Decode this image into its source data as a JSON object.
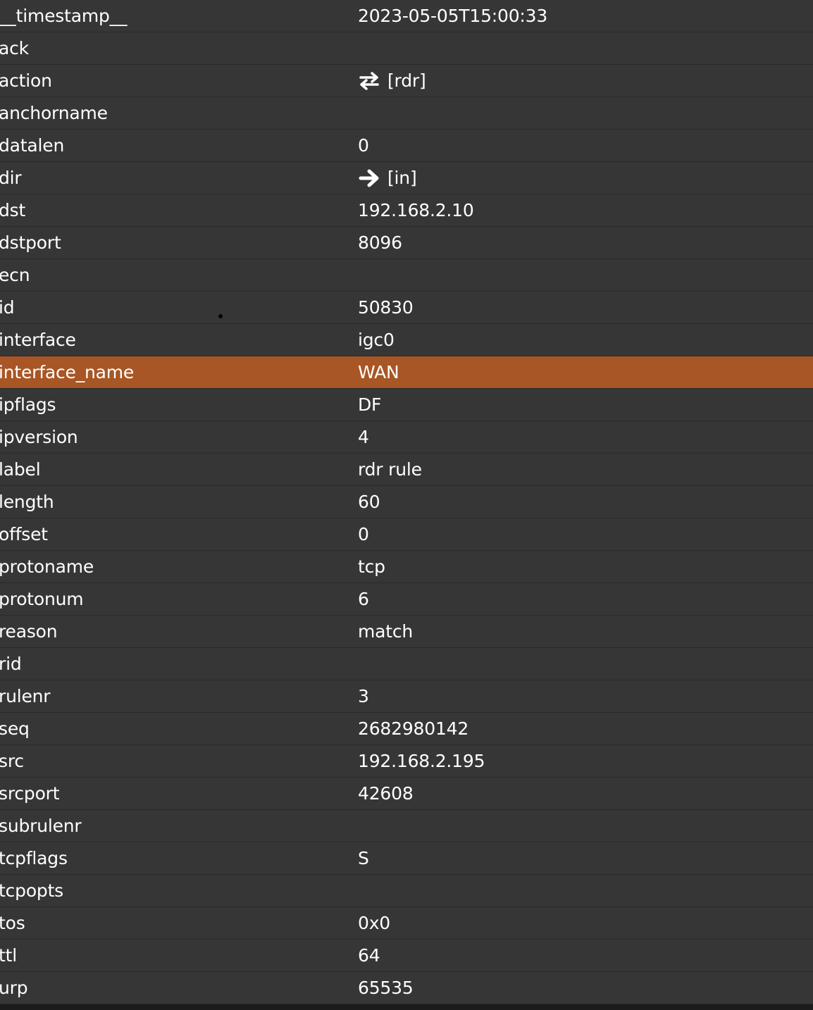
{
  "rows": [
    {
      "key": "__timestamp__",
      "value": "2023-05-05T15:00:33"
    },
    {
      "key": "ack",
      "value": ""
    },
    {
      "key": "action",
      "value": "[rdr]",
      "icon": "swap-arrows-icon"
    },
    {
      "key": "anchorname",
      "value": ""
    },
    {
      "key": "datalen",
      "value": "0"
    },
    {
      "key": "dir",
      "value": "[in]",
      "icon": "arrow-right-icon"
    },
    {
      "key": "dst",
      "value": "192.168.2.10"
    },
    {
      "key": "dstport",
      "value": "8096"
    },
    {
      "key": "ecn",
      "value": ""
    },
    {
      "key": "id",
      "value": "50830"
    },
    {
      "key": "interface",
      "value": "igc0"
    },
    {
      "key": "interface_name",
      "value": "WAN",
      "selected": true
    },
    {
      "key": "ipflags",
      "value": "DF"
    },
    {
      "key": "ipversion",
      "value": "4"
    },
    {
      "key": "label",
      "value": "rdr rule"
    },
    {
      "key": "length",
      "value": "60"
    },
    {
      "key": "offset",
      "value": "0"
    },
    {
      "key": "protoname",
      "value": "tcp"
    },
    {
      "key": "protonum",
      "value": "6"
    },
    {
      "key": "reason",
      "value": "match"
    },
    {
      "key": "rid",
      "value": ""
    },
    {
      "key": "rulenr",
      "value": "3"
    },
    {
      "key": "seq",
      "value": "2682980142"
    },
    {
      "key": "src",
      "value": "192.168.2.195"
    },
    {
      "key": "srcport",
      "value": "42608"
    },
    {
      "key": "subrulenr",
      "value": ""
    },
    {
      "key": "tcpflags",
      "value": "S"
    },
    {
      "key": "tcpopts",
      "value": ""
    },
    {
      "key": "tos",
      "value": "0x0"
    },
    {
      "key": "ttl",
      "value": "64"
    },
    {
      "key": "urp",
      "value": "65535"
    }
  ],
  "colors": {
    "row_bg": "#363636",
    "selected_bg": "#a85625",
    "text": "#ffffff",
    "divider": "#2a2a2a"
  }
}
